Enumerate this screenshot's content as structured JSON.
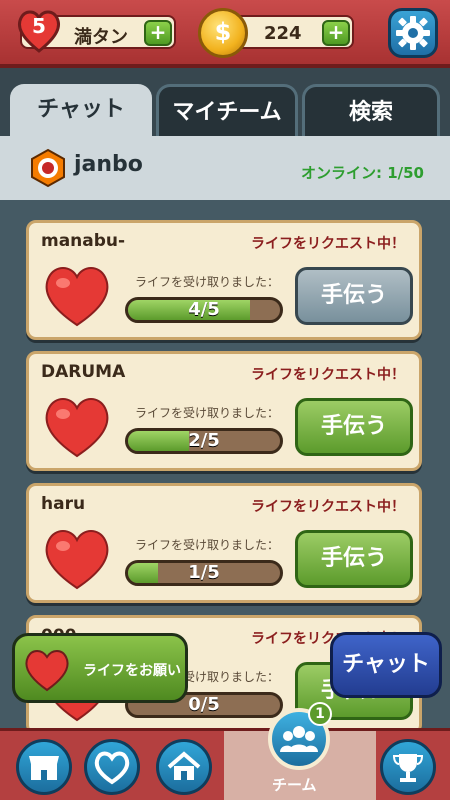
{
  "topbar": {
    "lives": "5",
    "lives_status": "満タン",
    "coins": "224",
    "plus": "+",
    "coin_symbol": "$"
  },
  "tabs": [
    "チャット",
    "マイチーム",
    "検索"
  ],
  "team": {
    "name": "janbo",
    "online": "オンライン: 1/50"
  },
  "requests": [
    {
      "user": "manabu-",
      "status": "ライフをリクエスト中！",
      "received_label": "ライフを受け取りました：",
      "progress": "4/5",
      "fill": 0.8,
      "button": "手伝う",
      "button_state": "disabled"
    },
    {
      "user": "DARUMA",
      "status": "ライフをリクエスト中！",
      "received_label": "ライフを受け取りました：",
      "progress": "2/5",
      "fill": 0.4,
      "button": "手伝う",
      "button_state": "active"
    },
    {
      "user": "haru",
      "status": "ライフをリクエスト中！",
      "received_label": "ライフを受け取りました：",
      "progress": "1/5",
      "fill": 0.2,
      "button": "手伝う",
      "button_state": "active"
    },
    {
      "user": "000",
      "status": "ライフをリクエスト中！",
      "received_label": "ライフを受け取りました：",
      "progress": "0/5",
      "fill": 0.0,
      "button": "手伝う",
      "button_state": "active"
    }
  ],
  "ask_life_button": "ライフをお願い",
  "chat_button": "チャット",
  "bottom_nav": {
    "team_label": "チーム",
    "team_badge": "1",
    "icons": [
      "shop-icon",
      "heart-icon",
      "home-icon",
      "team-icon",
      "trophy-icon"
    ]
  },
  "colors": {
    "topbar": "#b44040",
    "panel_bg": "#455a64",
    "card_bg": "#f6ecd2",
    "request_text": "#8b1e1e",
    "online_text": "#2e9e30",
    "help_active": "#5c9b2c",
    "help_disabled": "#78909c",
    "chat_button": "#233d91"
  }
}
